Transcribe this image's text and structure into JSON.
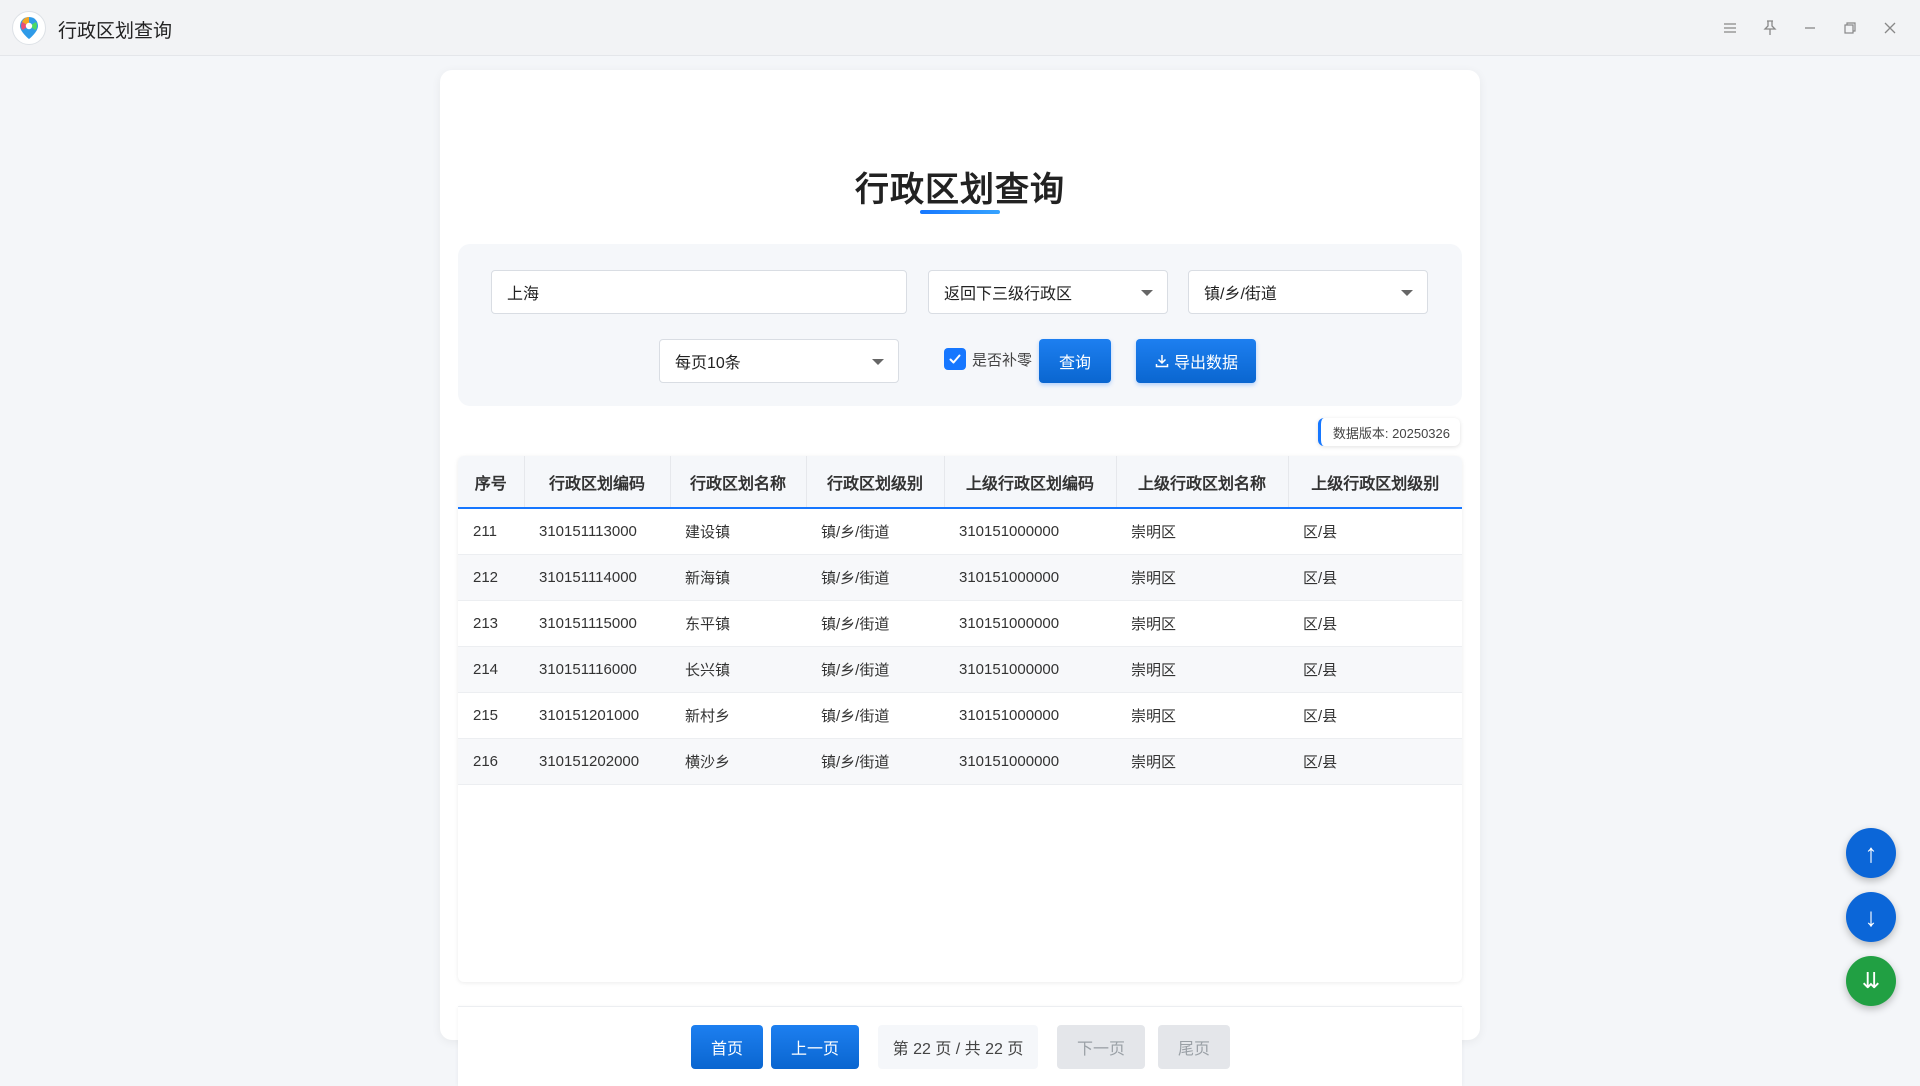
{
  "window": {
    "title": "行政区划查询",
    "controls": [
      "menu-icon",
      "pin-icon",
      "minimize-icon",
      "restore-icon",
      "close-icon"
    ]
  },
  "page": {
    "title": "行政区划查询",
    "accent_color": "#1677ff"
  },
  "filters": {
    "keyword_value": "上海",
    "level_select": "返回下三级行政区",
    "type_select": "镇/乡/街道",
    "page_size_select": "每页10条",
    "zero_pad_label": "是否补零",
    "zero_pad_checked": true,
    "query_button": "查询",
    "export_button": "导出数据"
  },
  "version": "数据版本: 20250326",
  "table": {
    "columns": [
      "序号",
      "行政区划编码",
      "行政区划名称",
      "行政区划级别",
      "上级行政区划编码",
      "上级行政区划名称",
      "上级行政区划级别"
    ],
    "rows": [
      [
        "211",
        "310151113000",
        "建设镇",
        "镇/乡/街道",
        "310151000000",
        "崇明区",
        "区/县"
      ],
      [
        "212",
        "310151114000",
        "新海镇",
        "镇/乡/街道",
        "310151000000",
        "崇明区",
        "区/县"
      ],
      [
        "213",
        "310151115000",
        "东平镇",
        "镇/乡/街道",
        "310151000000",
        "崇明区",
        "区/县"
      ],
      [
        "214",
        "310151116000",
        "长兴镇",
        "镇/乡/街道",
        "310151000000",
        "崇明区",
        "区/县"
      ],
      [
        "215",
        "310151201000",
        "新村乡",
        "镇/乡/街道",
        "310151000000",
        "崇明区",
        "区/县"
      ],
      [
        "216",
        "310151202000",
        "横沙乡",
        "镇/乡/街道",
        "310151000000",
        "崇明区",
        "区/县"
      ]
    ]
  },
  "pagination": {
    "first": "首页",
    "prev": "上一页",
    "info": "第 22 页 / 共 22 页",
    "next": "下一页",
    "last": "尾页"
  },
  "floating": {
    "up": "↑",
    "down": "↓",
    "bottom": "⇊"
  }
}
